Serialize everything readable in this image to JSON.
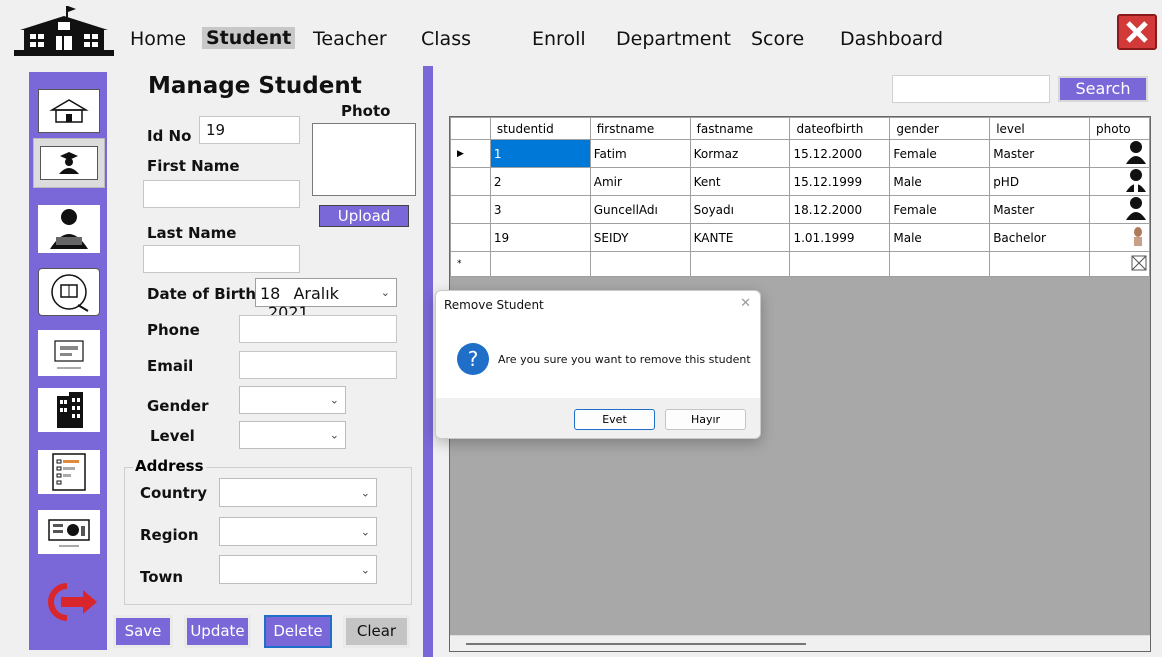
{
  "nav": {
    "items": [
      {
        "label": "Home"
      },
      {
        "label": "Student"
      },
      {
        "label": "Teacher"
      },
      {
        "label": "Class"
      },
      {
        "label": "Enroll"
      },
      {
        "label": "Department"
      },
      {
        "label": "Score"
      },
      {
        "label": "Dashboard"
      }
    ],
    "active": "Student"
  },
  "sidebar": {
    "icons": [
      "school-icon",
      "student-icon",
      "teacher-icon",
      "class-icon",
      "enroll-icon",
      "department-icon",
      "score-icon",
      "dashboard-icon",
      "logout-icon"
    ],
    "selected": "student-icon"
  },
  "form": {
    "title": "Manage Student",
    "photo_label": "Photo",
    "id_label": "Id No",
    "id_value": "19",
    "firstname_label": "First Name",
    "firstname_value": "",
    "lastname_label": "Last Name",
    "lastname_value": "",
    "upload_label": "Upload",
    "dob_label": "Date of Birth",
    "dob_day": "18",
    "dob_month": "Aralık",
    "dob_year": "2021",
    "phone_label": "Phone",
    "email_label": "Email",
    "gender_label": "Gender",
    "level_label": "Level",
    "address_label": "Address",
    "country_label": "Country",
    "region_label": "Region",
    "town_label": "Town"
  },
  "actions": {
    "save": "Save",
    "update": "Update",
    "delete": "Delete",
    "clear": "Clear"
  },
  "search": {
    "value": "",
    "button": "Search"
  },
  "grid": {
    "columns": [
      "studentid",
      "firstname",
      "fastname",
      "dateofbirth",
      "gender",
      "level",
      "photo"
    ],
    "rows": [
      {
        "studentid": "1",
        "firstname": "Fatim",
        "fastname": "Kormaz",
        "dateofbirth": "15.12.2000",
        "gender": "Female",
        "level": "Master"
      },
      {
        "studentid": "2",
        "firstname": "Amir",
        "fastname": "Kent",
        "dateofbirth": "15.12.1999",
        "gender": "Male",
        "level": "pHD"
      },
      {
        "studentid": "3",
        "firstname": "GuncellAdı",
        "fastname": "Soyadı",
        "dateofbirth": "18.12.2000",
        "gender": "Female",
        "level": "Master"
      },
      {
        "studentid": "19",
        "firstname": "SEIDY",
        "fastname": "KANTE",
        "dateofbirth": "1.01.1999",
        "gender": "Male",
        "level": "Bachelor"
      }
    ],
    "new_row_marker": "*"
  },
  "dialog": {
    "title": "Remove Student",
    "message": "Are you sure you want to remove this student",
    "yes": "Evet",
    "no": "Hayır"
  },
  "colors": {
    "accent": "#7b68d8",
    "selection": "#0078d7",
    "close": "#d23a3a"
  }
}
